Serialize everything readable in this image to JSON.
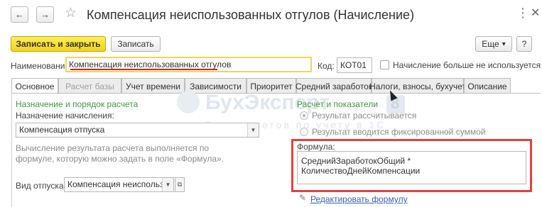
{
  "window": {
    "title": "Компенсация неиспользованных отгулов (Начисление)",
    "back_icon": "arrow-left-icon",
    "forward_icon": "arrow-right-icon",
    "favorite_icon": "star-icon",
    "more_icon": "more-dots-icon",
    "close_icon": "close-icon"
  },
  "toolbar": {
    "save_close_label": "Записать и закрыть",
    "save_label": "Записать",
    "more_label": "Еще",
    "more_arrow": "▾",
    "help_label": "?"
  },
  "form": {
    "name_label": "Наименование:",
    "name_value": "Компенсация неиспользованных отгулов",
    "code_label": "Код:",
    "code_value": "КОТ01",
    "unused_label": "Начисление больше не используется",
    "unused_checked": false
  },
  "tabs": [
    {
      "label": "Основное",
      "state": "active"
    },
    {
      "label": "Расчет базы",
      "state": "disabled"
    },
    {
      "label": "Учет времени",
      "state": "normal"
    },
    {
      "label": "Зависимости",
      "state": "normal"
    },
    {
      "label": "Приоритет",
      "state": "normal"
    },
    {
      "label": "Средний заработок",
      "state": "normal"
    },
    {
      "label": "Налоги, взносы, бухучет",
      "state": "normal"
    },
    {
      "label": "Описание",
      "state": "normal"
    }
  ],
  "main": {
    "purpose_section": "Назначение и порядок расчета",
    "purpose_label": "Назначение начисления:",
    "purpose_value": "Компенсация отпуска",
    "description": "Вычисление результата расчета выполняется по формуле, которую можно задать в поле «Формула».",
    "vacation_label": "Вид отпуска:",
    "vacation_value": "Компенсация неиспользо",
    "calc_section": "Расчет и показатели",
    "radio_calculated": "Результат рассчитывается",
    "radio_fixed": "Результат вводится фиксированной суммой",
    "formula_label": "Формула:",
    "formula_value": "СреднийЗаработокОбщий * КоличествоДнейКомпенсации",
    "edit_formula_link": "Редактировать формулу"
  },
  "watermark": {
    "brand": "БухЭксперт",
    "digit": "8",
    "tagline": "База ответов по учету в 1С"
  },
  "colors": {
    "accent_yellow": "#f3d21b",
    "highlight_red": "#e2423f",
    "section_green": "#3e9b3e",
    "link_blue": "#3a5fb5"
  }
}
